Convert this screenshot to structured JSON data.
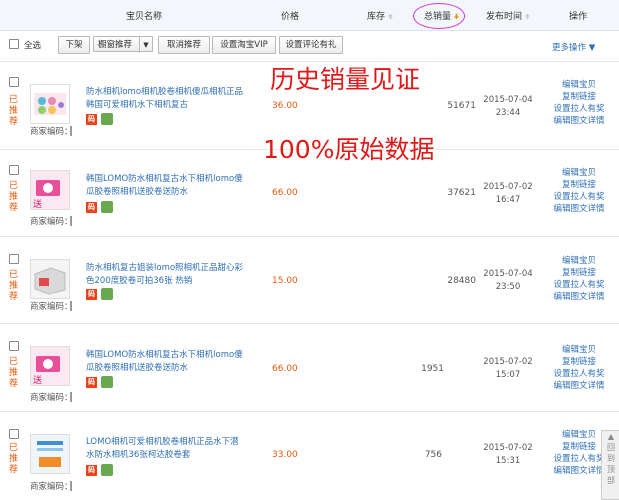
{
  "header": {
    "name_col": "宝贝名称",
    "price_col": "价格",
    "stock_col": "库存",
    "sales_col": "总销量",
    "time_col": "发布时间",
    "ops_col": "操作"
  },
  "toolbar": {
    "select_all": "全选",
    "btn_delist": "下架",
    "btn_window": "橱窗推荐",
    "btn_cancel": "取消推荐",
    "btn_vip": "设置淘宝VIP",
    "btn_review": "设置评论有礼",
    "more_ops": "更多操作"
  },
  "overlay": {
    "line1": "历史销量见证",
    "line2": "100%原始数据"
  },
  "rows": [
    {
      "tag": "已推荐",
      "title": "防水相机lomo相机胶卷相机傻瓜相机正品韩国可爱相机水下相机复古",
      "merchant": "商家编码：",
      "code_icon": "码",
      "price": "36.00",
      "sales": "51671",
      "date": "2015-07-04",
      "time": "23:44",
      "ops": [
        "编辑宝贝",
        "复制链接",
        "设置拉人有奖",
        "编辑图文详情"
      ]
    },
    {
      "tag": "已推荐",
      "title": "韩国LOMO防水相机复古水下相机lomo傻瓜胶卷照相机送胶卷送防水",
      "merchant": "商家编码：",
      "code_icon": "码",
      "price": "66.00",
      "sales": "37621",
      "date": "2015-07-02",
      "time": "16:47",
      "ops": [
        "编辑宝贝",
        "复制链接",
        "设置拉人有奖",
        "编辑图文详情"
      ]
    },
    {
      "tag": "已推荐",
      "title": "防水相机复古姐装lomo照相机正品甜心彩色200度胶卷可拍36张 热销",
      "merchant": "商家编码：",
      "code_icon": "码",
      "price": "15.00",
      "sales": "28480",
      "date": "2015-07-04",
      "time": "23:50",
      "ops": [
        "编辑宝贝",
        "复制链接",
        "设置拉人有奖",
        "编辑图文详情"
      ]
    },
    {
      "tag": "已推荐",
      "title": "韩国LOMO防水相机复古水下相机lomo傻瓜胶卷照相机送胶卷送防水",
      "merchant": "商家编码：",
      "code_icon": "码",
      "price": "66.00",
      "sales": "1951",
      "date": "2015-07-02",
      "time": "15:07",
      "ops": [
        "编辑宝贝",
        "复制链接",
        "设置拉人有奖",
        "编辑图文详情"
      ]
    },
    {
      "tag": "已推荐",
      "title": "LOMO相机可爱相机胶卷相机正品水下潜水防水相机36张柯达胶卷套",
      "merchant": "商家编码：",
      "code_icon": "码",
      "price": "33.00",
      "sales": "756",
      "date": "2015-07-02",
      "time": "15:31",
      "ops": [
        "编辑宝贝",
        "复制链接",
        "设置拉人有奖",
        "编辑图文详情"
      ]
    }
  ],
  "side_float": {
    "top_label": "回到顶部"
  }
}
